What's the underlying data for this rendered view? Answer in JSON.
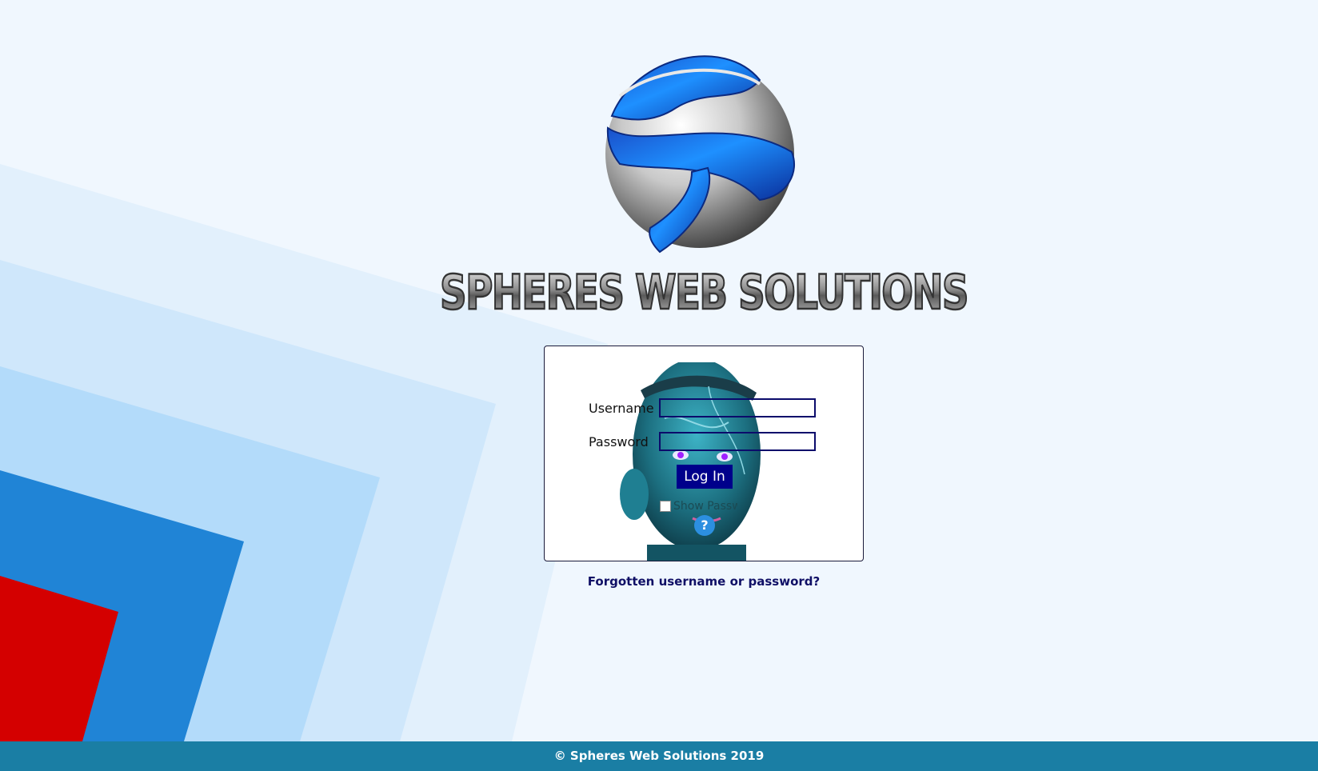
{
  "branding": {
    "logo_icon": "sphere-s-logo",
    "company_name": "SPHERES WEB SOLUTIONS"
  },
  "login": {
    "username_label": "Username",
    "password_label": "Password",
    "username_value": "",
    "password_value": "",
    "login_button": "Log In",
    "show_password_label": "Show Password",
    "help_icon": "?",
    "forgot_link": "Forgotten username or password?"
  },
  "footer": {
    "copyright": "© Spheres Web Solutions 2019"
  },
  "colors": {
    "background": "#f0f7fe",
    "footer": "#1a7ea4",
    "button": "#00008b",
    "accent_red": "#d40000",
    "accent_blue": "#2080d8"
  }
}
